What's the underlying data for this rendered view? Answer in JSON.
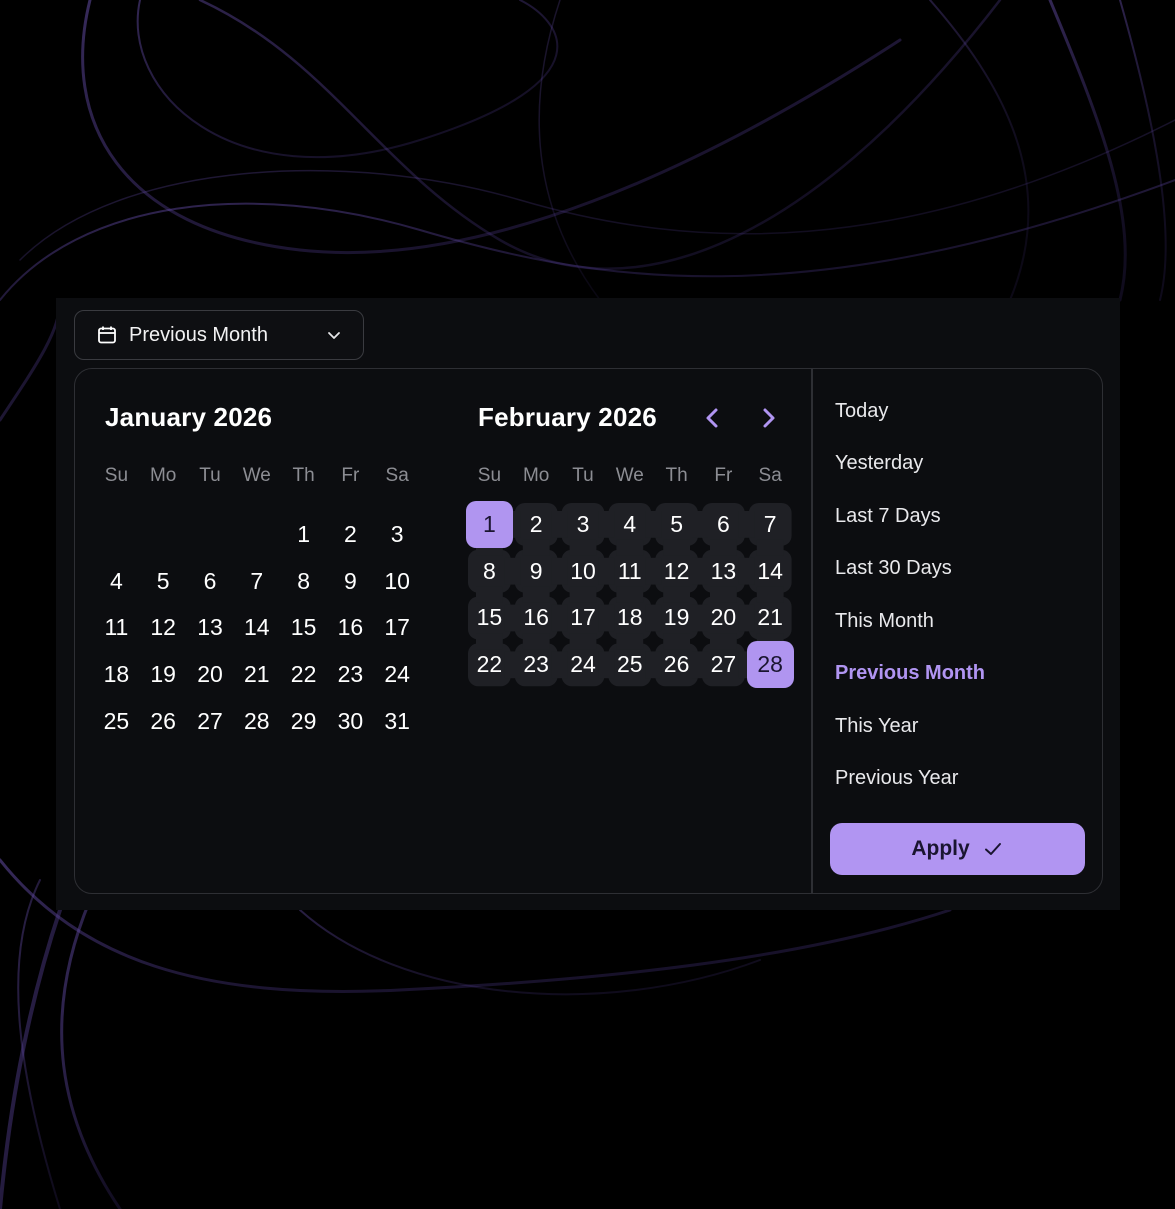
{
  "trigger": {
    "label": "Previous Month",
    "icon": "calendar-icon"
  },
  "weekdays": [
    "Su",
    "Mo",
    "Tu",
    "We",
    "Th",
    "Fr",
    "Sa"
  ],
  "calendars": [
    {
      "title": "January 2026",
      "days": [
        "",
        "",
        "",
        "",
        "1",
        "2",
        "3",
        "4",
        "5",
        "6",
        "7",
        "8",
        "9",
        "10",
        "11",
        "12",
        "13",
        "14",
        "15",
        "16",
        "17",
        "18",
        "19",
        "20",
        "21",
        "22",
        "23",
        "24",
        "25",
        "26",
        "27",
        "28",
        "29",
        "30",
        "31"
      ]
    },
    {
      "title": "February 2026",
      "days": [
        "1",
        "2",
        "3",
        "4",
        "5",
        "6",
        "7",
        "8",
        "9",
        "10",
        "11",
        "12",
        "13",
        "14",
        "15",
        "16",
        "17",
        "18",
        "19",
        "20",
        "21",
        "22",
        "23",
        "24",
        "25",
        "26",
        "27",
        "28"
      ],
      "range_start": "1",
      "range_end": "28"
    }
  ],
  "nav": {
    "prev_icon": "chevron-left-icon",
    "next_icon": "chevron-right-icon"
  },
  "presets": [
    {
      "label": "Today"
    },
    {
      "label": "Yesterday"
    },
    {
      "label": "Last 7 Days"
    },
    {
      "label": "Last 30 Days"
    },
    {
      "label": "This Month"
    },
    {
      "label": "Previous Month",
      "active": true
    },
    {
      "label": "This Year"
    },
    {
      "label": "Previous Year"
    }
  ],
  "apply": {
    "label": "Apply",
    "icon": "check-icon"
  },
  "colors": {
    "accent": "#b195f2",
    "panel": "#0c0d10",
    "range_cell": "#1f2025",
    "border": "#2e2f34"
  }
}
